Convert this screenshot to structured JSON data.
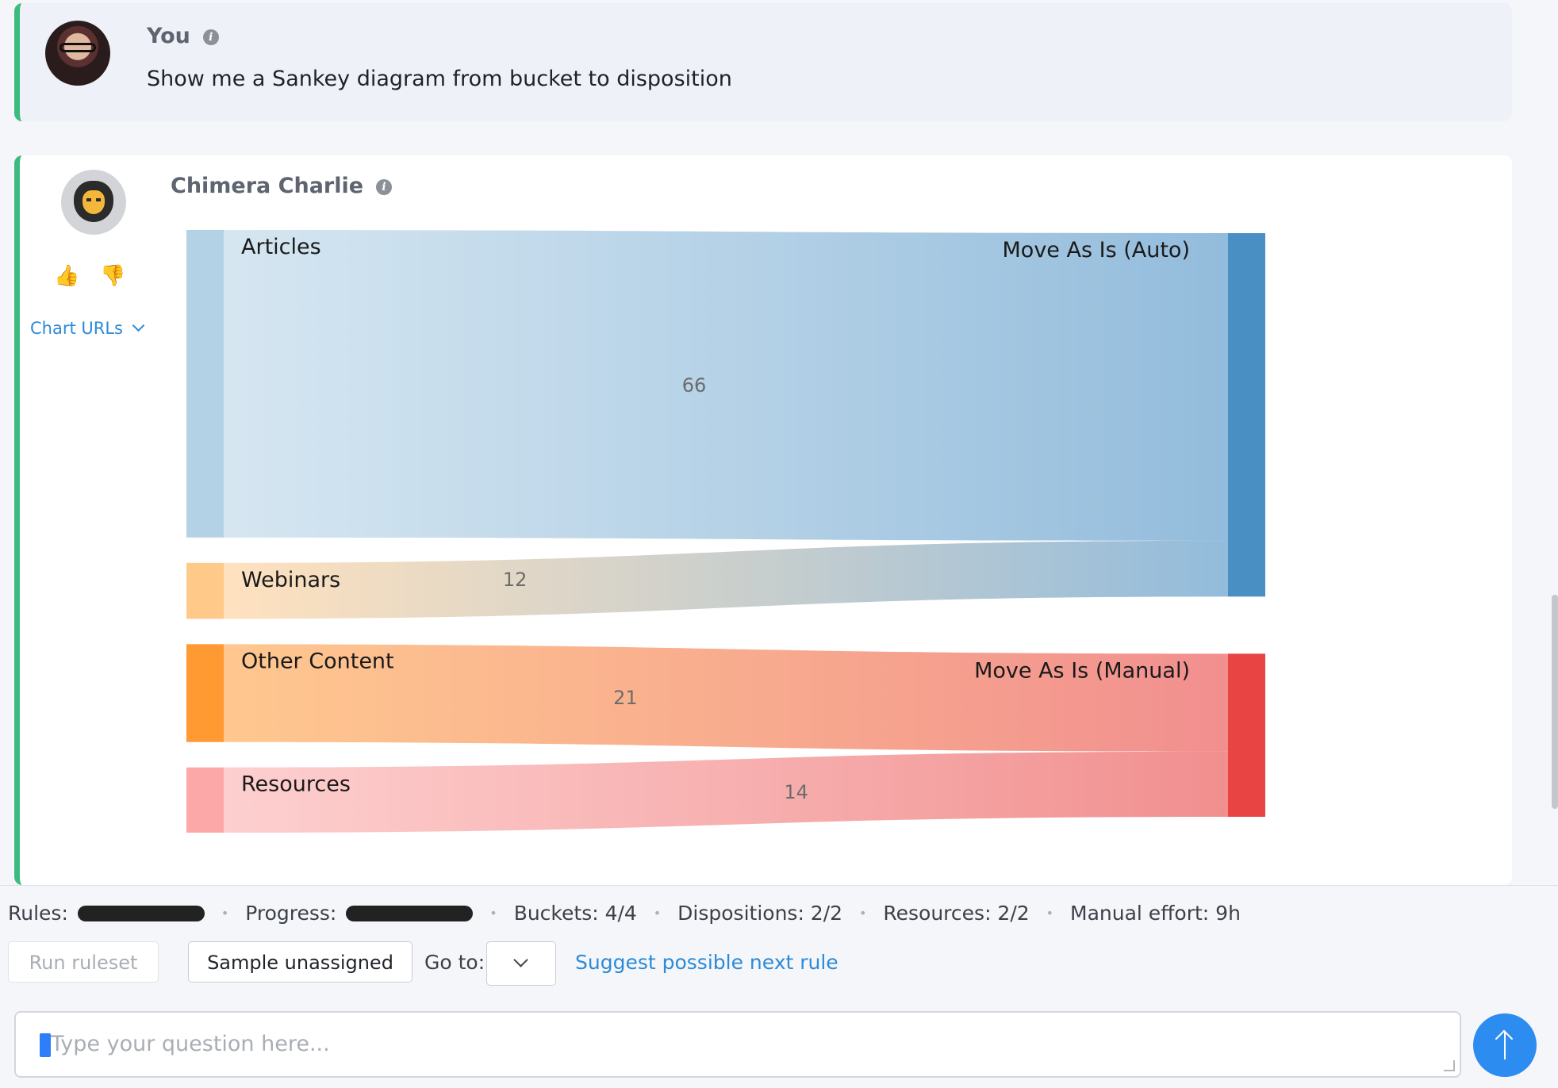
{
  "user_message": {
    "author": "You",
    "text": "Show me a Sankey diagram from bucket to disposition"
  },
  "bot_message": {
    "author": "Chimera Charlie",
    "chart_urls_label": "Chart URLs"
  },
  "chart_data": {
    "type": "sankey",
    "nodes": [
      {
        "name": "Articles",
        "side": "source",
        "color": "#b4d2e6"
      },
      {
        "name": "Webinars",
        "side": "source",
        "color": "#ffc98a"
      },
      {
        "name": "Other Content",
        "side": "source",
        "color": "#ff9a33"
      },
      {
        "name": "Resources",
        "side": "source",
        "color": "#fca8a8"
      },
      {
        "name": "Move As Is (Auto)",
        "side": "target",
        "color": "#4a8fc4"
      },
      {
        "name": "Move As Is (Manual)",
        "side": "target",
        "color": "#e84444"
      }
    ],
    "links": [
      {
        "source": "Articles",
        "target": "Move As Is (Auto)",
        "value": 66
      },
      {
        "source": "Webinars",
        "target": "Move As Is (Auto)",
        "value": 12
      },
      {
        "source": "Other Content",
        "target": "Move As Is (Manual)",
        "value": 21
      },
      {
        "source": "Resources",
        "target": "Move As Is (Manual)",
        "value": 14
      }
    ]
  },
  "status": {
    "rules_label": "Rules:",
    "progress_label": "Progress:",
    "buckets": "Buckets: 4/4",
    "dispositions": "Dispositions: 2/2",
    "resources": "Resources: 2/2",
    "manual_effort": "Manual effort: 9h"
  },
  "actions": {
    "run_ruleset": "Run ruleset",
    "sample_unassigned": "Sample unassigned",
    "goto_label": "Go to:",
    "suggest": "Suggest possible next rule"
  },
  "composer": {
    "placeholder": "Type your question here..."
  }
}
